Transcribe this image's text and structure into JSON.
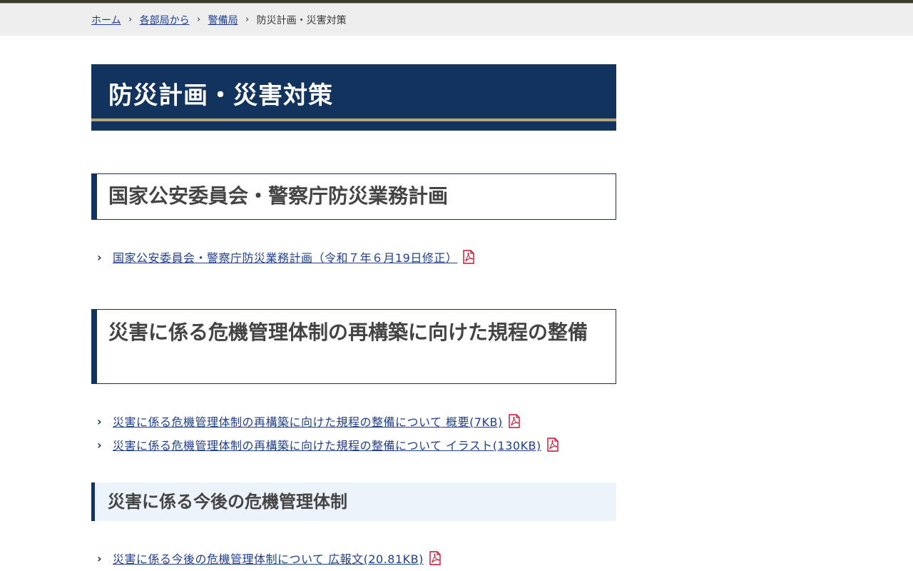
{
  "breadcrumb": {
    "items": [
      "ホーム",
      "各部局から",
      "警備局"
    ],
    "current": "防災計画・災害対策"
  },
  "page": {
    "title": "防災計画・災害対策"
  },
  "sections": [
    {
      "heading": "国家公安委員会・警察庁防災業務計画",
      "links": [
        "国家公安委員会・警察庁防災業務計画（令和７年６月19日修正）"
      ]
    },
    {
      "heading": "災害に係る危機管理体制の再構築に向けた規程の整備",
      "links": [
        "災害に係る危機管理体制の再構築に向けた規程の整備について 概要(7KB)",
        "災害に係る危機管理体制の再構築に向けた規程の整備について イラスト(130KB)"
      ]
    },
    {
      "heading": "災害に係る今後の危機管理体制",
      "links": [
        "災害に係る今後の危機管理体制について 広報文(20.81KB)"
      ]
    }
  ],
  "icons": {
    "link_chevron": "chevron-right-icon",
    "pdf": "pdf-icon",
    "pdf_color": "#c8102e"
  },
  "colors": {
    "navy": "#13335f",
    "gold": "#b3a67c",
    "link": "#1f3f8c"
  }
}
